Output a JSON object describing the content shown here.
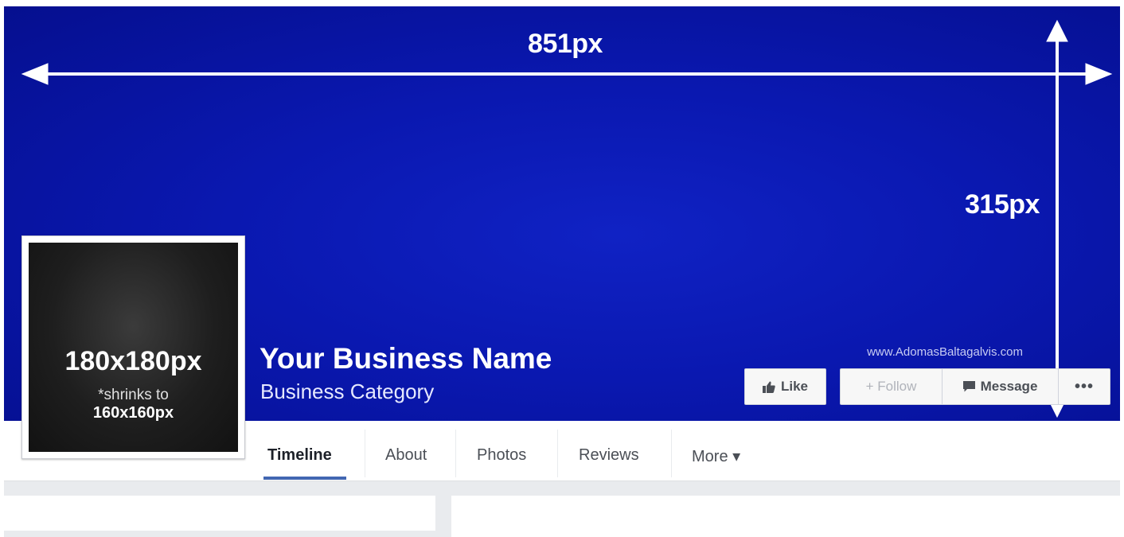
{
  "annotations": {
    "width_label": "851px",
    "height_label": "315px"
  },
  "profile": {
    "size_label": "180x180px",
    "note": "*shrinks to",
    "note_size": "160x160px"
  },
  "page": {
    "business_name": "Your Business Name",
    "business_category": "Business Category",
    "website": "www.AdomasBaltagalvis.com"
  },
  "actions": {
    "like_label": "Like",
    "follow_label": "+ Follow",
    "message_label": "Message",
    "more_label": "•••"
  },
  "tabs": [
    {
      "label": "Timeline",
      "active": true
    },
    {
      "label": "About",
      "active": false
    },
    {
      "label": "Photos",
      "active": false
    },
    {
      "label": "Reviews",
      "active": false
    },
    {
      "label": "More ▾",
      "active": false
    }
  ],
  "icons": {
    "like": "thumbs-up-icon",
    "message": "speech-bubble-icon"
  },
  "colors": {
    "cover": "#0a18b0",
    "accent": "#4267b2"
  }
}
